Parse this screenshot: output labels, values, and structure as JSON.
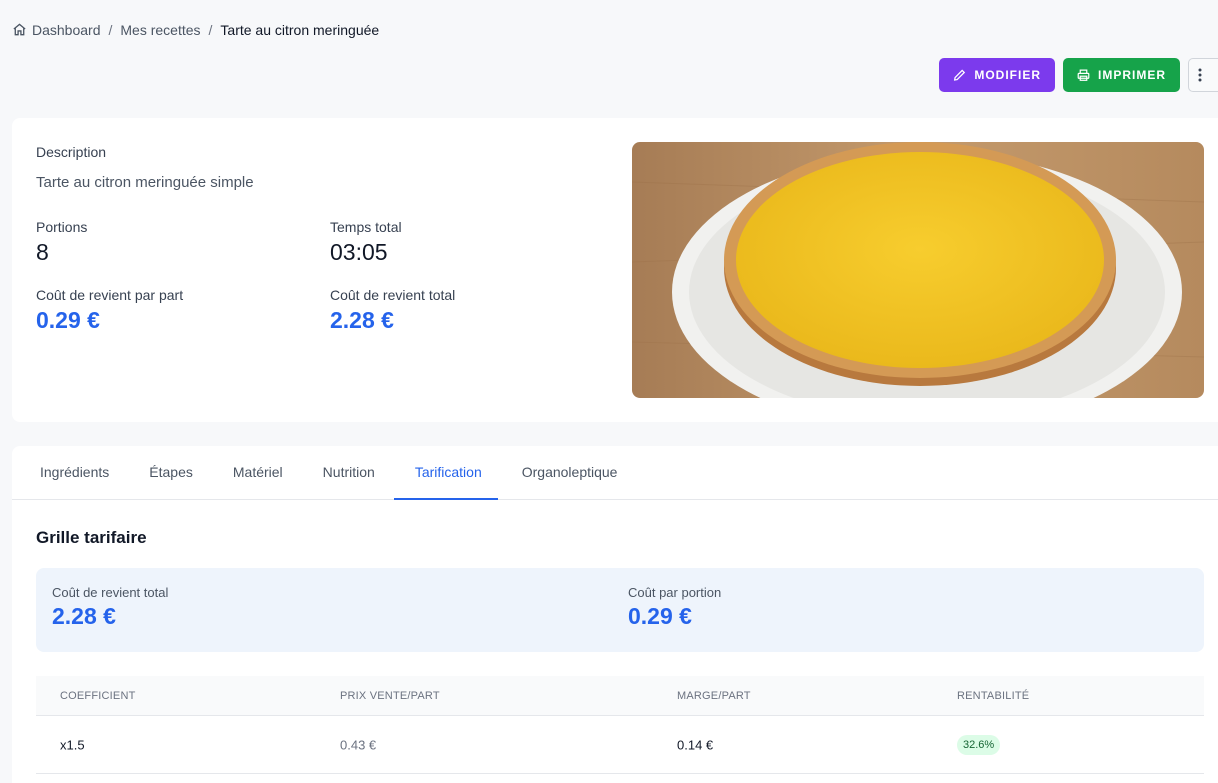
{
  "breadcrumb": {
    "home": "Dashboard",
    "section": "Mes recettes",
    "current": "Tarte au citron meringuée"
  },
  "actions": {
    "edit_label": "MODIFIER",
    "print_label": "IMPRIMER",
    "edit_color": "#7c3aed",
    "print_color": "#16a34a"
  },
  "recipe": {
    "description_label": "Description",
    "description": "Tarte au citron meringuée simple",
    "portions_label": "Portions",
    "portions": "8",
    "time_label": "Temps total",
    "time": "03:05",
    "cost_per_part_label": "Coût de revient par part",
    "cost_per_part": "0.29 €",
    "cost_total_label": "Coût de revient total",
    "cost_total": "2.28 €"
  },
  "tabs": [
    {
      "label": "Ingrédients"
    },
    {
      "label": "Étapes"
    },
    {
      "label": "Matériel"
    },
    {
      "label": "Nutrition"
    },
    {
      "label": "Tarification"
    },
    {
      "label": "Organoleptique"
    }
  ],
  "active_tab": "Tarification",
  "pricing": {
    "title": "Grille tarifaire",
    "total_label": "Coût de revient total",
    "total": "2.28 €",
    "portion_label": "Coût par portion",
    "portion": "0.29 €",
    "columns": [
      "COEFFICIENT",
      "PRIX VENTE/PART",
      "MARGE/PART",
      "RENTABILITÉ"
    ],
    "rows": [
      {
        "coef": "x1.5",
        "prix": "0.43 €",
        "marge": "0.14 €",
        "rentabilite": "32.6%"
      }
    ]
  }
}
